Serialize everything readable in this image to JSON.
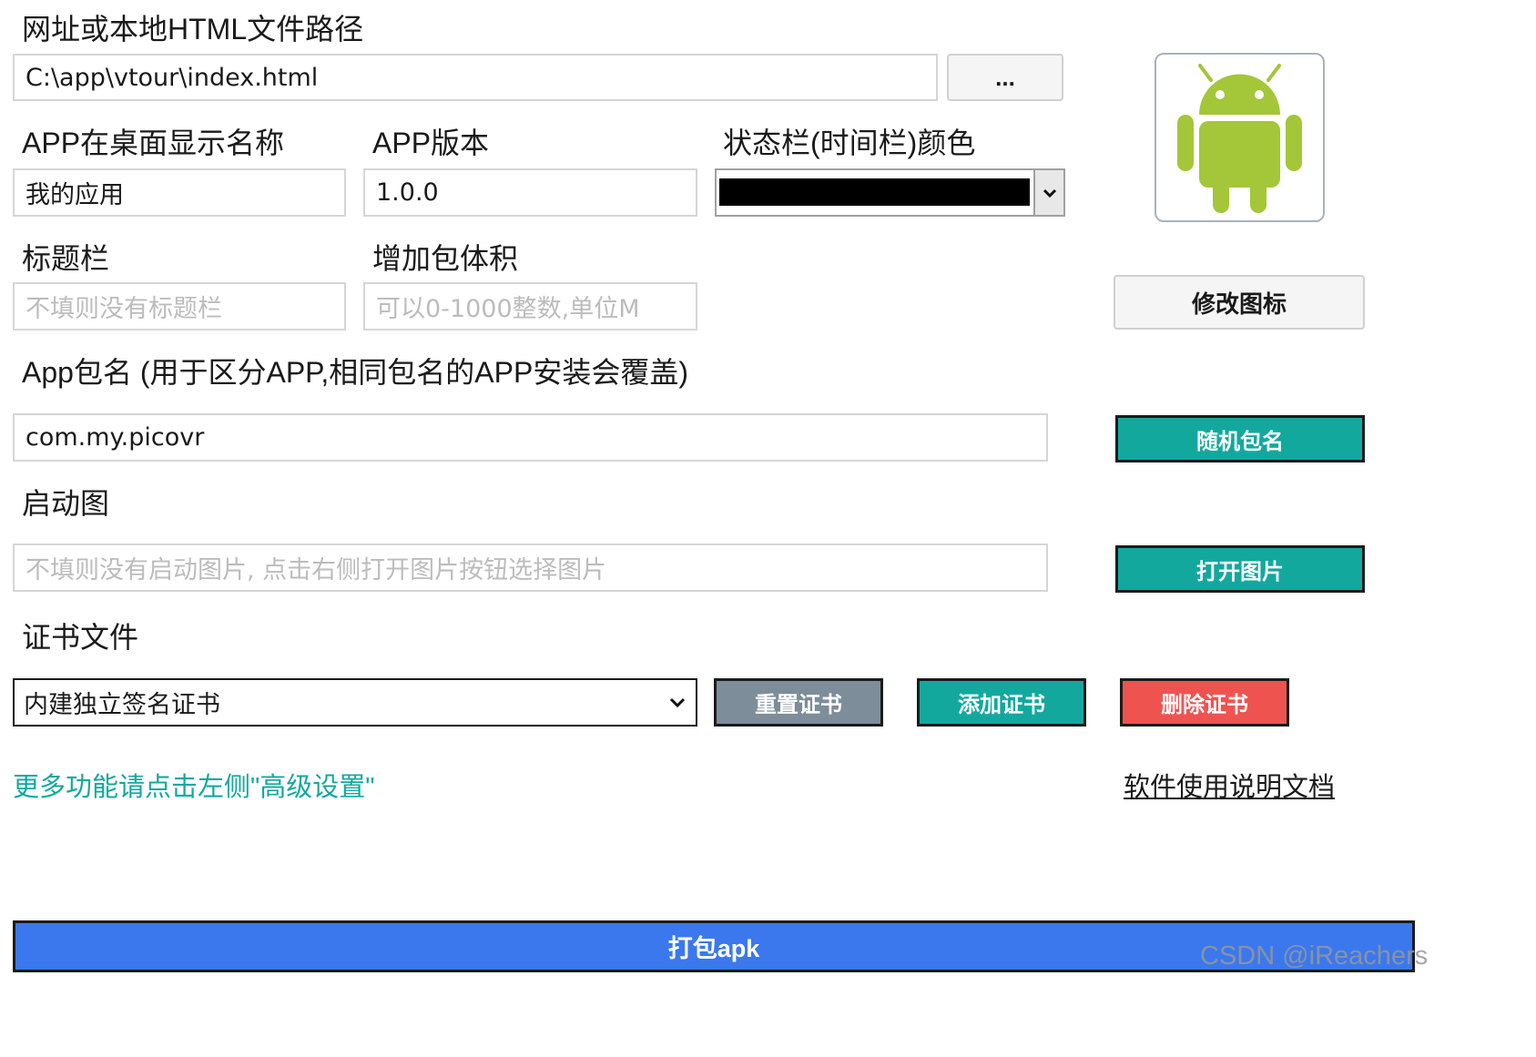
{
  "colors": {
    "teal": "#13a89e",
    "gray_button": "#7d8d99",
    "red_button": "#ef5350",
    "blue_button": "#3b78ee",
    "status_bar_swatch": "#000000",
    "android_green": "#a4c639"
  },
  "url_section": {
    "label": "网址或本地HTML文件路径",
    "value": "C:\\app\\vtour\\index.html",
    "browse_label": "..."
  },
  "app_name": {
    "label": "APP在桌面显示名称",
    "value": "我的应用"
  },
  "app_version": {
    "label": "APP版本",
    "value": "1.0.0"
  },
  "status_bar": {
    "label": "状态栏(时间栏)颜色",
    "icon": "chevron-down-icon"
  },
  "title_bar": {
    "label": "标题栏",
    "placeholder": "不填则没有标题栏"
  },
  "package_size": {
    "label": "增加包体积",
    "placeholder": "可以0-1000整数,单位M"
  },
  "app_icon": {
    "icon": "android-icon",
    "change_label": "修改图标"
  },
  "package_name": {
    "label": "App包名 (用于区分APP,相同包名的APP安装会覆盖)",
    "value": "com.my.picovr",
    "random_label": "随机包名"
  },
  "splash": {
    "label": "启动图",
    "placeholder": "不填则没有启动图片, 点击右侧打开图片按钮选择图片",
    "open_label": "打开图片"
  },
  "certificate": {
    "label": "证书文件",
    "selected": "内建独立签名证书",
    "reset_label": "重置证书",
    "add_label": "添加证书",
    "delete_label": "删除证书"
  },
  "links": {
    "advanced": "更多功能请点击左侧\"高级设置\"",
    "docs": "软件使用说明文档"
  },
  "build": {
    "label": "打包apk"
  },
  "watermark": "CSDN @iReachers"
}
